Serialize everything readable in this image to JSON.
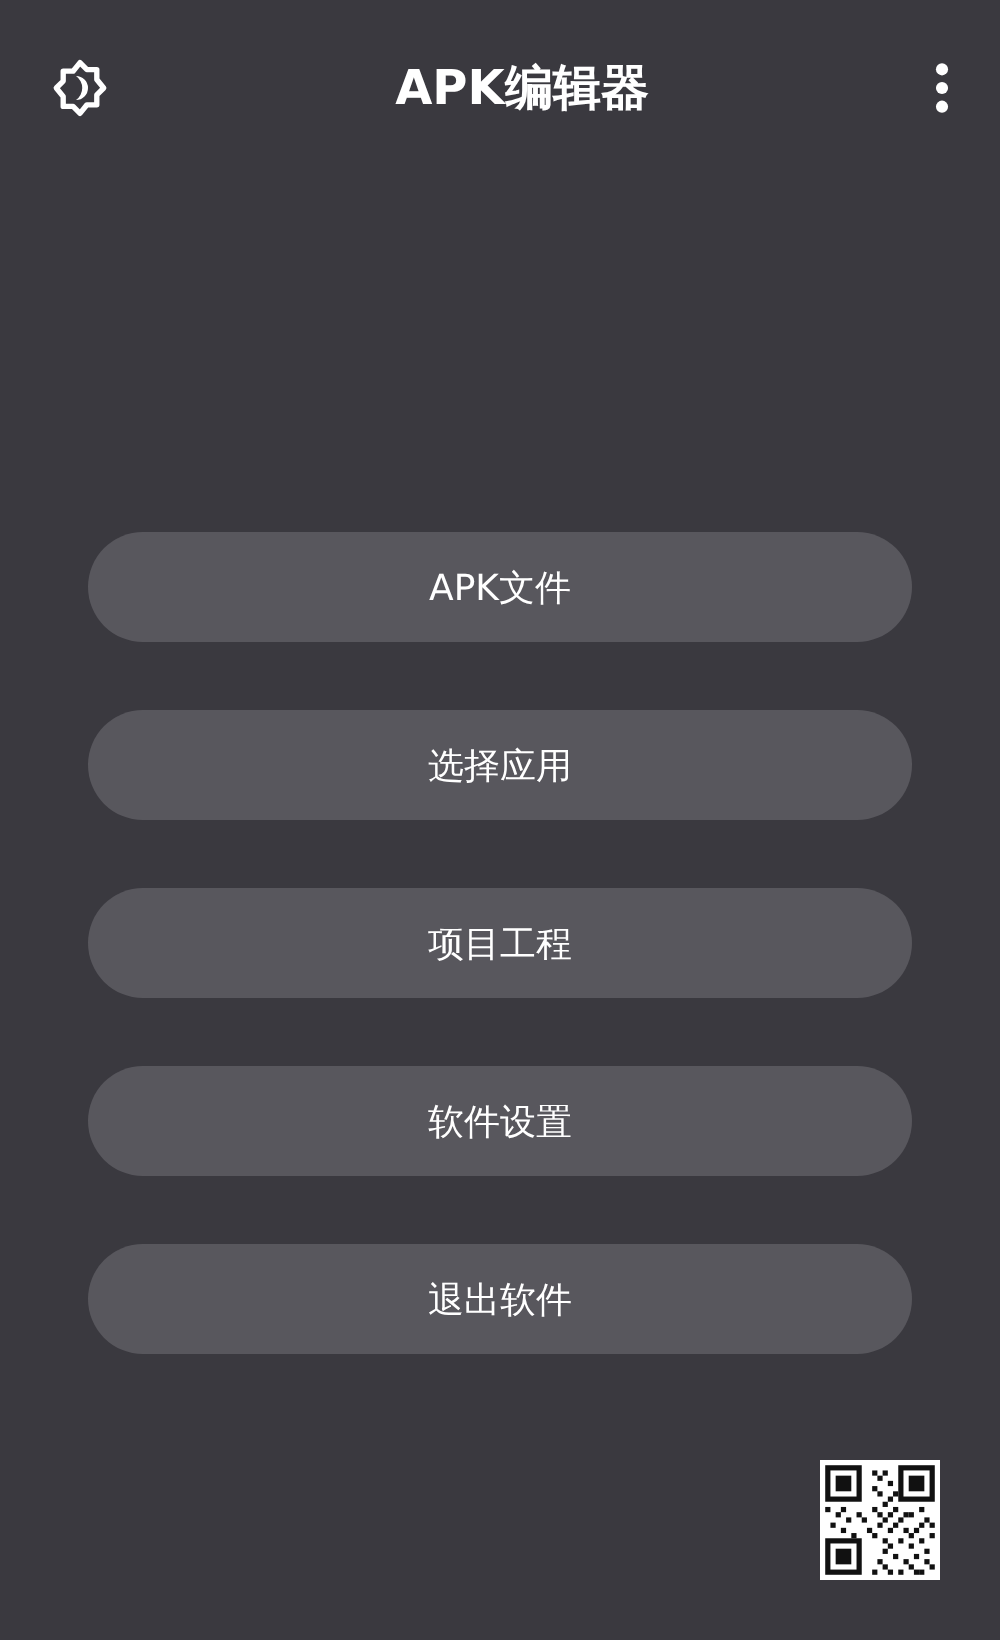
{
  "app_bar": {
    "title": "APK编辑器"
  },
  "menu_buttons": [
    {
      "label": "APK文件"
    },
    {
      "label": "选择应用"
    },
    {
      "label": "项目工程"
    },
    {
      "label": "软件设置"
    },
    {
      "label": "退出软件"
    }
  ]
}
